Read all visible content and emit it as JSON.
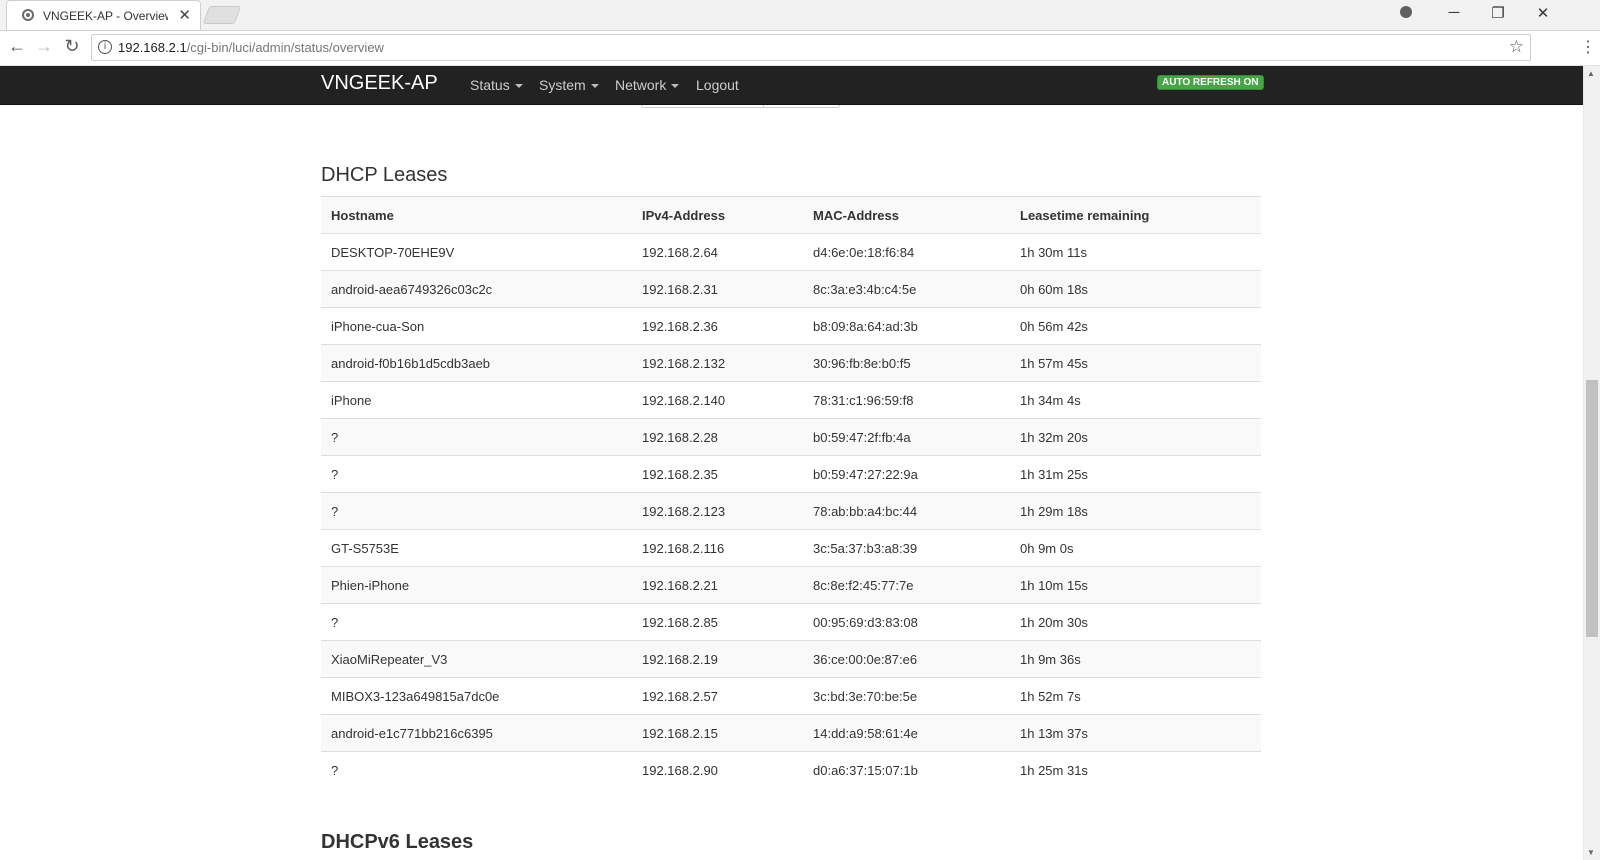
{
  "browser": {
    "tab_title": "VNGEEK-AP - Overview -",
    "tab_close": "✕",
    "url_host": "192.168.2.1",
    "url_path": "/cgi-bin/luci/admin/status/overview",
    "minimize": "─",
    "restore": "❐",
    "close": "✕",
    "back": "←",
    "forward": "→",
    "reload": "↻",
    "star": "☆",
    "menu": "⋮",
    "info": "i"
  },
  "navbar": {
    "brand": "VNGEEK-AP",
    "menus": [
      "Status",
      "System",
      "Network"
    ],
    "logout": "Logout",
    "badge": "AUTO REFRESH ON"
  },
  "dhcp": {
    "title": "DHCP Leases",
    "headers": [
      "Hostname",
      "IPv4-Address",
      "MAC-Address",
      "Leasetime remaining"
    ],
    "rows": [
      [
        "DESKTOP-70EHE9V",
        "192.168.2.64",
        "d4:6e:0e:18:f6:84",
        "1h 30m 11s"
      ],
      [
        "android-aea6749326c03c2c",
        "192.168.2.31",
        "8c:3a:e3:4b:c4:5e",
        "0h 60m 18s"
      ],
      [
        "iPhone-cua-Son",
        "192.168.2.36",
        "b8:09:8a:64:ad:3b",
        "0h 56m 42s"
      ],
      [
        "android-f0b16b1d5cdb3aeb",
        "192.168.2.132",
        "30:96:fb:8e:b0:f5",
        "1h 57m 45s"
      ],
      [
        "iPhone",
        "192.168.2.140",
        "78:31:c1:96:59:f8",
        "1h 34m 4s"
      ],
      [
        "?",
        "192.168.2.28",
        "b0:59:47:2f:fb:4a",
        "1h 32m 20s"
      ],
      [
        "?",
        "192.168.2.35",
        "b0:59:47:27:22:9a",
        "1h 31m 25s"
      ],
      [
        "?",
        "192.168.2.123",
        "78:ab:bb:a4:bc:44",
        "1h 29m 18s"
      ],
      [
        "GT-S5753E",
        "192.168.2.116",
        "3c:5a:37:b3:a8:39",
        "0h 9m 0s"
      ],
      [
        "Phien-iPhone",
        "192.168.2.21",
        "8c:8e:f2:45:77:7e",
        "1h 10m 15s"
      ],
      [
        "?",
        "192.168.2.85",
        "00:95:69:d3:83:08",
        "1h 20m 30s"
      ],
      [
        "XiaoMiRepeater_V3",
        "192.168.2.19",
        "36:ce:00:0e:87:e6",
        "1h 9m 36s"
      ],
      [
        "MIBOX3-123a649815a7dc0e",
        "192.168.2.57",
        "3c:bd:3e:70:be:5e",
        "1h 52m 7s"
      ],
      [
        "android-e1c771bb216c6395",
        "192.168.2.15",
        "14:dd:a9:58:61:4e",
        "1h 13m 37s"
      ],
      [
        "?",
        "192.168.2.90",
        "d0:a6:37:15:07:1b",
        "1h 25m 31s"
      ]
    ]
  },
  "dhcpv6": {
    "title": "DHCPv6 Leases"
  },
  "scrollbar": {
    "up": "▲",
    "down": "▼"
  }
}
